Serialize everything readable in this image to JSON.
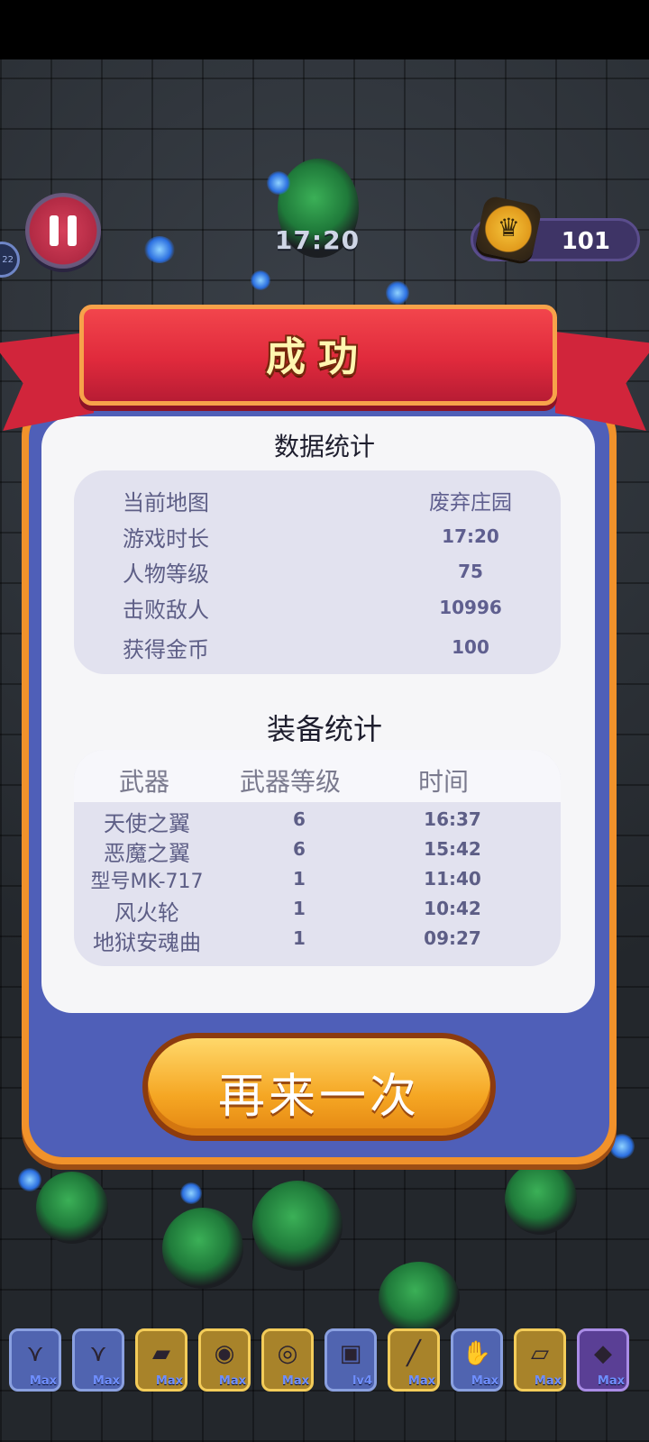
{
  "hud": {
    "timer": "17:20",
    "coins": "101",
    "side_level": "22"
  },
  "banner": {
    "title": "成功"
  },
  "stats": {
    "title": "数据统计",
    "rows": [
      {
        "label": "当前地图",
        "value": "废弃庄园"
      },
      {
        "label": "游戏时长",
        "value": "17:20"
      },
      {
        "label": "人物等级",
        "value": "75"
      },
      {
        "label": "击败敌人",
        "value": "10996"
      },
      {
        "label": "获得金币",
        "value": "100"
      }
    ]
  },
  "equipment": {
    "title": "装备统计",
    "headers": [
      "武器",
      "武器等级",
      "时间"
    ],
    "rows": [
      {
        "weapon": "天使之翼",
        "level": "6",
        "time": "16:37"
      },
      {
        "weapon": "恶魔之翼",
        "level": "6",
        "time": "15:42"
      },
      {
        "weapon": "型号MK-717",
        "level": "1",
        "time": "11:40"
      },
      {
        "weapon": "风火轮",
        "level": "1",
        "time": "10:42"
      },
      {
        "weapon": "地狱安魂曲",
        "level": "1",
        "time": "09:27"
      }
    ]
  },
  "retry_button": "再来一次",
  "hotbar": [
    {
      "icon": "angel-wings-icon",
      "level": "Max",
      "frame": "blue"
    },
    {
      "icon": "demon-wings-icon",
      "level": "Max",
      "frame": "blue"
    },
    {
      "icon": "gun-icon",
      "level": "Max",
      "frame": "gold"
    },
    {
      "icon": "fire-wheel-icon",
      "level": "Max",
      "frame": "gold"
    },
    {
      "icon": "requiem-disc-icon",
      "level": "Max",
      "frame": "gold"
    },
    {
      "icon": "stone-tablet-icon",
      "level": "lv4",
      "frame": "blue"
    },
    {
      "icon": "torch-icon",
      "level": "Max",
      "frame": "gold"
    },
    {
      "icon": "gauntlet-icon",
      "level": "Max",
      "frame": "blue"
    },
    {
      "icon": "scroll-icon",
      "level": "Max",
      "frame": "gold"
    },
    {
      "icon": "crystal-icon",
      "level": "Max",
      "frame": "purple"
    }
  ]
}
